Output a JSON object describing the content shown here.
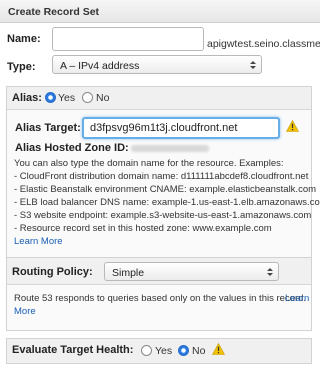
{
  "header": {
    "title": "Create Record Set"
  },
  "name": {
    "label": "Name:",
    "value": "",
    "suffix": "apigwtest.seino.classmet"
  },
  "type": {
    "label": "Type:",
    "selected": "A – IPv4 address"
  },
  "alias": {
    "label": "Alias:",
    "options": [
      "Yes",
      "No"
    ],
    "selected": "Yes",
    "target_label": "Alias Target:",
    "target_value": "d3fpsvg96m1t3j.cloudfront.net",
    "zone_label": "Alias Hosted Zone ID:",
    "help_intro": "You can also type the domain name for the resource. Examples:",
    "examples": [
      "- CloudFront distribution domain name: d111111abcdef8.cloudfront.net",
      "- Elastic Beanstalk environment CNAME: example.elasticbeanstalk.com",
      "- ELB load balancer DNS name: example-1.us-east-1.elb.amazonaws.com",
      "- S3 website endpoint: example.s3-website-us-east-1.amazonaws.com",
      "- Resource record set in this hosted zone: www.example.com"
    ],
    "learn_more": "Learn More"
  },
  "routing": {
    "label": "Routing Policy:",
    "selected": "Simple",
    "description": "Route 53 responds to queries based only on the values in this record.",
    "learn_more_1": "Learn",
    "learn_more_2": "More"
  },
  "health": {
    "label": "Evaluate Target Health:",
    "options": [
      "Yes",
      "No"
    ],
    "selected": "No"
  },
  "colors": {
    "link": "#1a5fb4",
    "radio_selected": "#2a7ae0",
    "focus": "#66aee8",
    "warning": "#f2c200"
  }
}
